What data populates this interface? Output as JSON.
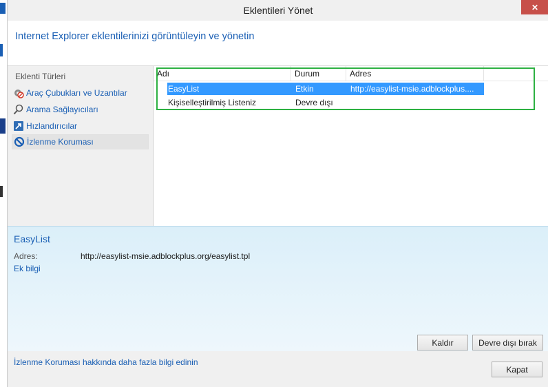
{
  "window": {
    "title": "Eklentileri Yönet",
    "close_glyph": "✕",
    "header": "Internet Explorer eklentilerinizi görüntüleyin ve yönetin"
  },
  "left_pane": {
    "title": "Eklenti Türleri",
    "items": [
      {
        "label": "Araç Çubukları ve Uzantılar",
        "icon": "gear-blocked-icon",
        "selected": false
      },
      {
        "label": "Arama Sağlayıcıları",
        "icon": "magnifier-icon",
        "selected": false
      },
      {
        "label": "Hızlandırıcılar",
        "icon": "accelerator-icon",
        "selected": false
      },
      {
        "label": "İzlenme Koruması",
        "icon": "blocked-circle-icon",
        "selected": true
      }
    ]
  },
  "list": {
    "columns": [
      "Adı",
      "Durum",
      "Adres"
    ],
    "rows": [
      {
        "name": "EasyList",
        "status": "Etkin",
        "address": "http://easylist-msie.adblockplus....",
        "selected": true
      },
      {
        "name": "Kişiselleştirilmiş Listeniz",
        "status": "Devre dışı",
        "address": "",
        "selected": false
      }
    ]
  },
  "details": {
    "title": "EasyList",
    "address_label": "Adres:",
    "address_value": "http://easylist-msie.adblockplus.org/easylist.tpl",
    "more_info_link": "Ek bilgi",
    "remove_button": "Kaldır",
    "disable_button": "Devre dışı bırak"
  },
  "footer": {
    "link": "İzlenme Koruması hakkında daha fazla bilgi edinin",
    "close_button": "Kapat"
  },
  "colors": {
    "accent_blue": "#1a5fb4",
    "selection": "#3399ff",
    "highlight_box": "#2db142",
    "close_red": "#c7504a"
  }
}
